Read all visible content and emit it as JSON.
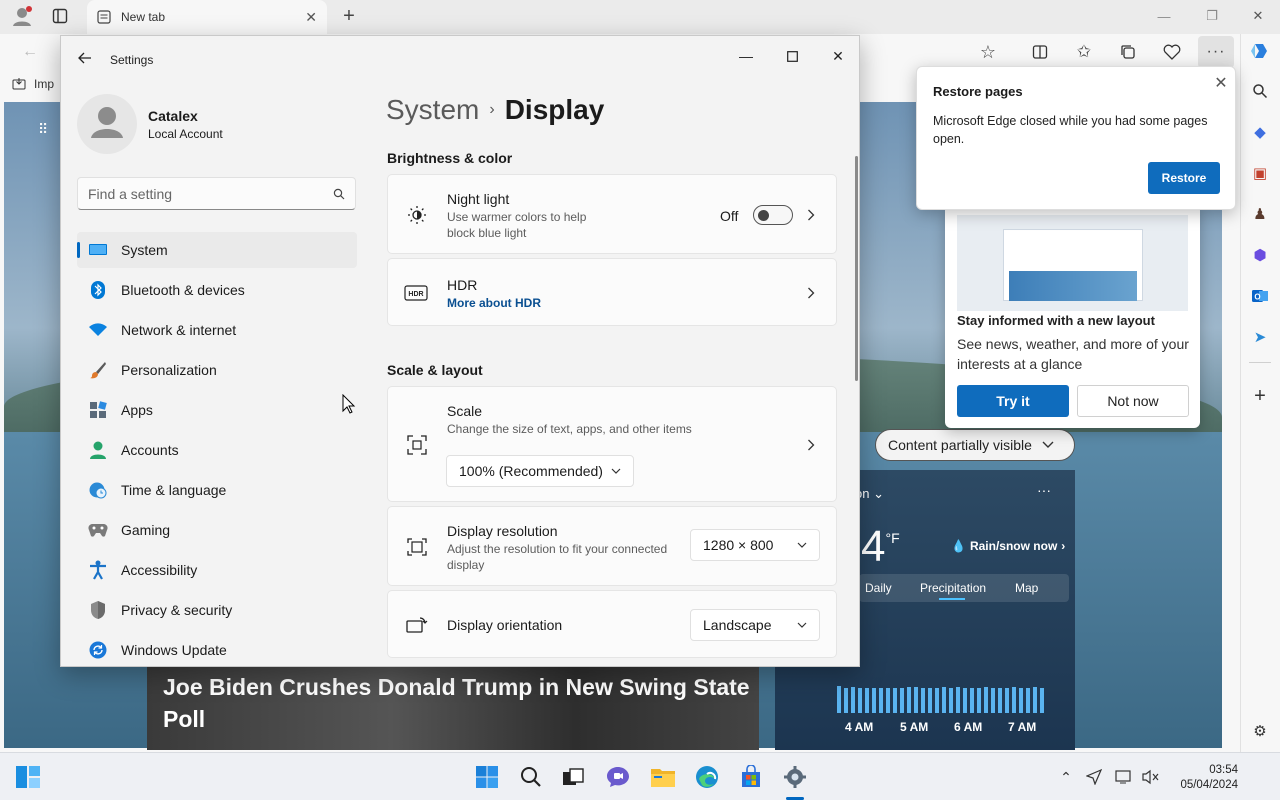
{
  "browser": {
    "tab_title": "New tab",
    "favorites_item": "Imp",
    "restore_popup": {
      "title": "Restore pages",
      "message": "Microsoft Edge closed while you had some pages open.",
      "button": "Restore"
    },
    "layout_promo": {
      "title": "Stay informed with a new layout",
      "description": "See news, weather, and more of your interests at a glance",
      "primary": "Try it",
      "secondary": "Not now"
    },
    "content_visibility": "Content partially visible",
    "news_headline": "Joe Biden Crushes Donald Trump in New Swing State Poll",
    "weather": {
      "temp": "4",
      "unit": "°F",
      "condition": "Rain/snow now",
      "tabs": [
        "Daily",
        "Precipitation",
        "Map"
      ],
      "times": [
        "4 AM",
        "5 AM",
        "6 AM",
        "7 AM"
      ],
      "location_partial": "on"
    }
  },
  "settings": {
    "window_title": "Settings",
    "user": {
      "name": "Catalex",
      "account_type": "Local Account"
    },
    "search": {
      "placeholder": "Find a setting"
    },
    "nav": [
      {
        "label": "System",
        "icon": "monitor-icon",
        "color": "#0078d4"
      },
      {
        "label": "Bluetooth & devices",
        "icon": "bluetooth-icon",
        "color": "#0078d4"
      },
      {
        "label": "Network & internet",
        "icon": "wifi-icon",
        "color": "#0a82e0"
      },
      {
        "label": "Personalization",
        "icon": "brush-icon",
        "color": "#d36b2c"
      },
      {
        "label": "Apps",
        "icon": "apps-icon",
        "color": "#4a6a8a"
      },
      {
        "label": "Accounts",
        "icon": "person-icon",
        "color": "#25a36a"
      },
      {
        "label": "Time & language",
        "icon": "globe-clock-icon",
        "color": "#2a8ad6"
      },
      {
        "label": "Gaming",
        "icon": "gamepad-icon",
        "color": "#6a6a6a"
      },
      {
        "label": "Accessibility",
        "icon": "accessibility-icon",
        "color": "#1a73c8"
      },
      {
        "label": "Privacy & security",
        "icon": "shield-icon",
        "color": "#7a7a7a"
      },
      {
        "label": "Windows Update",
        "icon": "update-icon",
        "color": "#1a78d8"
      }
    ],
    "breadcrumb": {
      "parent": "System",
      "current": "Display"
    },
    "sections": {
      "brightness": "Brightness & color",
      "scale_layout": "Scale & layout"
    },
    "night_light": {
      "title": "Night light",
      "subtitle": "Use warmer colors to help block blue light",
      "state": "Off"
    },
    "hdr": {
      "title": "HDR",
      "link": "More about HDR",
      "icon_label": "HDR"
    },
    "scale": {
      "title": "Scale",
      "subtitle": "Change the size of text, apps, and other items",
      "value": "100% (Recommended)"
    },
    "resolution": {
      "title": "Display resolution",
      "subtitle": "Adjust the resolution to fit your connected display",
      "value": "1280 × 800"
    },
    "orientation": {
      "title": "Display orientation",
      "value": "Landscape"
    }
  },
  "taskbar": {
    "time": "03:54",
    "date": "05/04/2024"
  }
}
